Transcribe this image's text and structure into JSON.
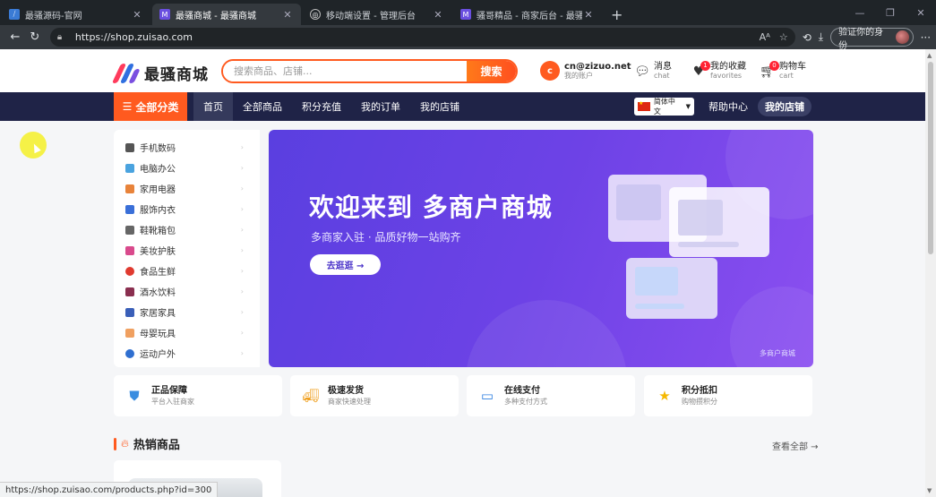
{
  "browser": {
    "tabs": [
      {
        "title": "最骚源码-官网",
        "favicon_color": "#3a7bd5",
        "active": false
      },
      {
        "title": "最骚商城 - 最骚商城",
        "favicon_color": "#6a4fe0",
        "active": true
      },
      {
        "title": "移动端设置 - 管理后台",
        "favicon_color": "#888888",
        "active": false
      },
      {
        "title": "骚哥精品 - 商家后台 - 最骚商城",
        "favicon_color": "#6a4fe0",
        "active": false
      }
    ],
    "url": "https://shop.zuisao.com",
    "verify_label": "验证你的身份",
    "status_url": "https://shop.zuisao.com/products.php?id=300"
  },
  "header": {
    "logo_text": "最骚商城",
    "search_placeholder": "搜索商品、店铺...",
    "search_button": "搜索",
    "account_initial": "c",
    "account_name": "cn@zizuo.net",
    "account_sub": "我的账户",
    "messages": {
      "label": "消息",
      "sub": "chat"
    },
    "favorites": {
      "label": "我的收藏",
      "sub": "favorites",
      "badge": "1"
    },
    "cart": {
      "label": "购物车",
      "sub": "cart",
      "badge": "0"
    }
  },
  "nav": {
    "all_categories": "全部分类",
    "links": [
      "首页",
      "全部商品",
      "积分充值",
      "我的订单",
      "我的店铺"
    ],
    "active_index": 0,
    "language": "简体中文",
    "help": "帮助中心",
    "my_store": "我的店铺"
  },
  "categories": [
    {
      "label": "手机数码",
      "color": "#555555"
    },
    {
      "label": "电脑办公",
      "color": "#4aa3df"
    },
    {
      "label": "家用电器",
      "color": "#e8833a"
    },
    {
      "label": "服饰内衣",
      "color": "#3a6fd8"
    },
    {
      "label": "鞋靴箱包",
      "color": "#666666"
    },
    {
      "label": "美妆护肤",
      "color": "#d94a8c"
    },
    {
      "label": "食品生鲜",
      "color": "#e03a2f"
    },
    {
      "label": "酒水饮料",
      "color": "#8a2f4f"
    },
    {
      "label": "家居家具",
      "color": "#3a5fb8"
    },
    {
      "label": "母婴玩具",
      "color": "#f0a060"
    },
    {
      "label": "运动户外",
      "color": "#2f6fd0"
    }
  ],
  "banner": {
    "title": "欢迎来到 多商户商城",
    "subtitle": "多商家入驻 · 品质好物一站购齐",
    "button": "去逛逛 →",
    "tag": "多商户商城"
  },
  "features": [
    {
      "title": "正品保障",
      "sub": "平台入驻商家",
      "icon": "shield-icon",
      "color": "#3a8de0"
    },
    {
      "title": "极速发货",
      "sub": "商家快速处理",
      "icon": "truck-icon",
      "color": "#f0a020"
    },
    {
      "title": "在线支付",
      "sub": "多种支付方式",
      "icon": "card-icon",
      "color": "#2f7fe0"
    },
    {
      "title": "积分抵扣",
      "sub": "购物攒积分",
      "icon": "star-icon",
      "color": "#f5b800"
    }
  ],
  "hot": {
    "title": "热销商品",
    "see_all": "查看全部 →"
  }
}
